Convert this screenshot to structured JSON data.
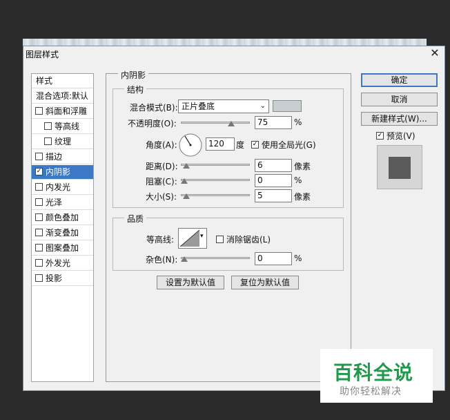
{
  "window": {
    "title": "图层样式",
    "close": "✕"
  },
  "sidebar": {
    "items": [
      {
        "label": "样式",
        "checkbox": false,
        "checked": false
      },
      {
        "label": "混合选项:默认",
        "checkbox": false,
        "checked": false
      },
      {
        "label": "斜面和浮雕",
        "checkbox": true,
        "checked": false
      },
      {
        "label": "等高线",
        "checkbox": true,
        "checked": false,
        "indent": true
      },
      {
        "label": "纹理",
        "checkbox": true,
        "checked": false,
        "indent": true
      },
      {
        "label": "描边",
        "checkbox": true,
        "checked": false
      },
      {
        "label": "内阴影",
        "checkbox": true,
        "checked": true,
        "selected": true
      },
      {
        "label": "内发光",
        "checkbox": true,
        "checked": false
      },
      {
        "label": "光泽",
        "checkbox": true,
        "checked": false
      },
      {
        "label": "颜色叠加",
        "checkbox": true,
        "checked": false
      },
      {
        "label": "渐变叠加",
        "checkbox": true,
        "checked": false
      },
      {
        "label": "图案叠加",
        "checkbox": true,
        "checked": false
      },
      {
        "label": "外发光",
        "checkbox": true,
        "checked": false
      },
      {
        "label": "投影",
        "checkbox": true,
        "checked": false
      }
    ]
  },
  "panel": {
    "title": "内阴影",
    "structure": {
      "title": "结构",
      "blend_mode_label": "混合模式(B):",
      "blend_mode_value": "正片叠底",
      "shadow_color": "#c8cfd3",
      "opacity_label": "不透明度(O):",
      "opacity_value": "75",
      "opacity_unit": "%",
      "opacity_fraction": 0.75,
      "angle_label": "角度(A):",
      "angle_value": "120",
      "angle_unit": "度",
      "global_light_label": "使用全局光(G)",
      "global_light_checked": true,
      "distance_label": "距离(D):",
      "distance_value": "6",
      "distance_unit": "像素",
      "distance_fraction": 0.03,
      "choke_label": "阻塞(C):",
      "choke_value": "0",
      "choke_unit": "%",
      "choke_fraction": 0.0,
      "size_label": "大小(S):",
      "size_value": "5",
      "size_unit": "像素",
      "size_fraction": 0.03
    },
    "quality": {
      "title": "品质",
      "contour_label": "等高线:",
      "antialias_label": "消除锯齿(L)",
      "antialias_checked": false,
      "noise_label": "杂色(N):",
      "noise_value": "0",
      "noise_unit": "%",
      "noise_fraction": 0.0
    },
    "set_default_label": "设置为默认值",
    "reset_default_label": "复位为默认值"
  },
  "actions": {
    "ok_label": "确定",
    "cancel_label": "取消",
    "new_style_label": "新建样式(W)...",
    "preview_label": "预览(V)",
    "preview_checked": true
  },
  "watermark": {
    "line1": "百科全说",
    "line2": "助你轻松解决"
  }
}
